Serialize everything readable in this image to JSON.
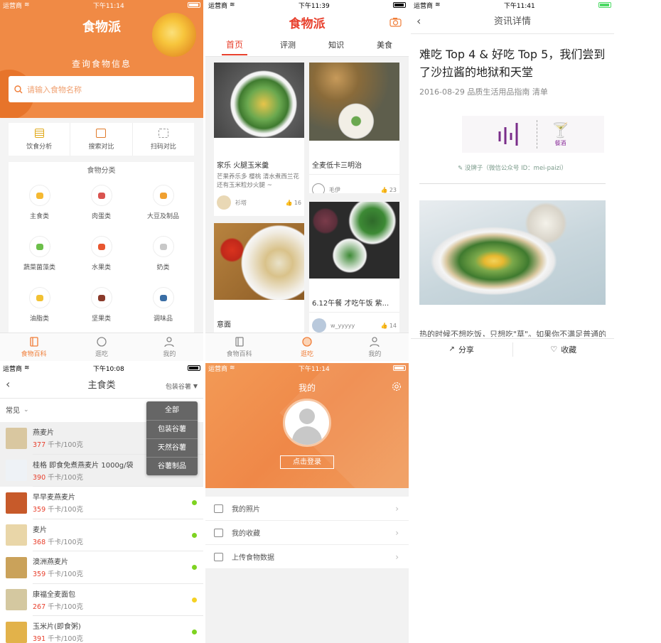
{
  "status": {
    "carrier": "运营商",
    "s1_time": "下午11:14",
    "s2_time": "下午11:39",
    "s3_time": "下午11:41",
    "s4_time": "下午10:08",
    "s5_time": "下午11:14"
  },
  "brand": "食物派",
  "home": {
    "subtitle": "查询食物信息",
    "search_placeholder": "请输入食物名称",
    "tools": [
      {
        "label": "饮食分析",
        "icon": "list-icon"
      },
      {
        "label": "搜索对比",
        "icon": "compare-icon"
      },
      {
        "label": "扫码对比",
        "icon": "scan-icon"
      }
    ],
    "category_title": "食物分类",
    "categories": [
      {
        "label": "主食类",
        "color": "#f5b932"
      },
      {
        "label": "肉蛋类",
        "color": "#d9534f"
      },
      {
        "label": "大豆及制品",
        "color": "#f0a030"
      },
      {
        "label": "蔬菜菌藻类",
        "color": "#6cbf4a"
      },
      {
        "label": "水果类",
        "color": "#e8562f"
      },
      {
        "label": "奶类",
        "color": "#c8c8c8"
      },
      {
        "label": "油脂类",
        "color": "#f2c133"
      },
      {
        "label": "坚果类",
        "color": "#8a3a2a"
      },
      {
        "label": "调味品",
        "color": "#3a6ea5"
      }
    ]
  },
  "tabs": {
    "items": [
      "食物百科",
      "逛吃",
      "我的"
    ]
  },
  "feed": {
    "tabs": [
      "首页",
      "评测",
      "知识",
      "美食"
    ],
    "cards": [
      {
        "title": "家乐 火腿玉米羹",
        "desc": "芒果养乐多 樱桃 清水煮西兰花 还有玉米粒炒火腿 ~",
        "user": "衫塔",
        "likes": "16"
      },
      {
        "title": "全麦低卡三明治",
        "desc": "",
        "user": "毛伊",
        "likes": "23"
      },
      {
        "title": "意面",
        "desc": "",
        "user": "",
        "likes": ""
      },
      {
        "title": "6.12午餐  才吃午饭 紫...",
        "desc": "",
        "user": "w_yyyyy",
        "likes": "14"
      }
    ]
  },
  "article": {
    "nav_title": "资讯详情",
    "title": "难吃 Top 4 & 好吃 Top 5，我们尝到了沙拉酱的地狱和天堂",
    "meta": "2016-08-29  品质生活用品指南  清单",
    "logo_text": "餐酒",
    "credit": "✎ 没牌子（微信公众号 ID：mei-paizi）",
    "body": "热的时候不想吃饭，只想吃\"草\"。如果你不满足普通的",
    "share": "分享",
    "fav": "收藏"
  },
  "list": {
    "title": "主食类",
    "filter": "包装谷薯",
    "sort": "常见",
    "dropdown": [
      "全部",
      "包装谷薯",
      "天然谷薯",
      "谷薯制品"
    ],
    "items": [
      {
        "name": "燕麦片",
        "kcal": "377",
        "unit": "千卡/100克",
        "dot": ""
      },
      {
        "name": "桂格 即食免煮燕麦片 1000g/袋",
        "kcal": "390",
        "unit": "千卡/100克",
        "dot": ""
      },
      {
        "name": "早早麦燕麦片",
        "kcal": "359",
        "unit": "千卡/100克",
        "dot": "#7ed321"
      },
      {
        "name": "麦片",
        "kcal": "368",
        "unit": "千卡/100克",
        "dot": "#7ed321"
      },
      {
        "name": "澳洲燕麦片",
        "kcal": "359",
        "unit": "千卡/100克",
        "dot": "#7ed321"
      },
      {
        "name": "康福全麦面包",
        "kcal": "267",
        "unit": "千卡/100克",
        "dot": "#f5d123"
      },
      {
        "name": "玉米片(即食粥)",
        "kcal": "391",
        "unit": "千卡/100克",
        "dot": "#7ed321"
      }
    ]
  },
  "me": {
    "title": "我的",
    "login": "点击登录",
    "menu": [
      {
        "label": "我的照片",
        "icon": "camera-icon"
      },
      {
        "label": "我的收藏",
        "icon": "folder-icon"
      },
      {
        "label": "上传食物数据",
        "icon": "upload-icon"
      }
    ]
  },
  "colors": {
    "accent": "#f07d37",
    "kcal": "#e8402d"
  }
}
